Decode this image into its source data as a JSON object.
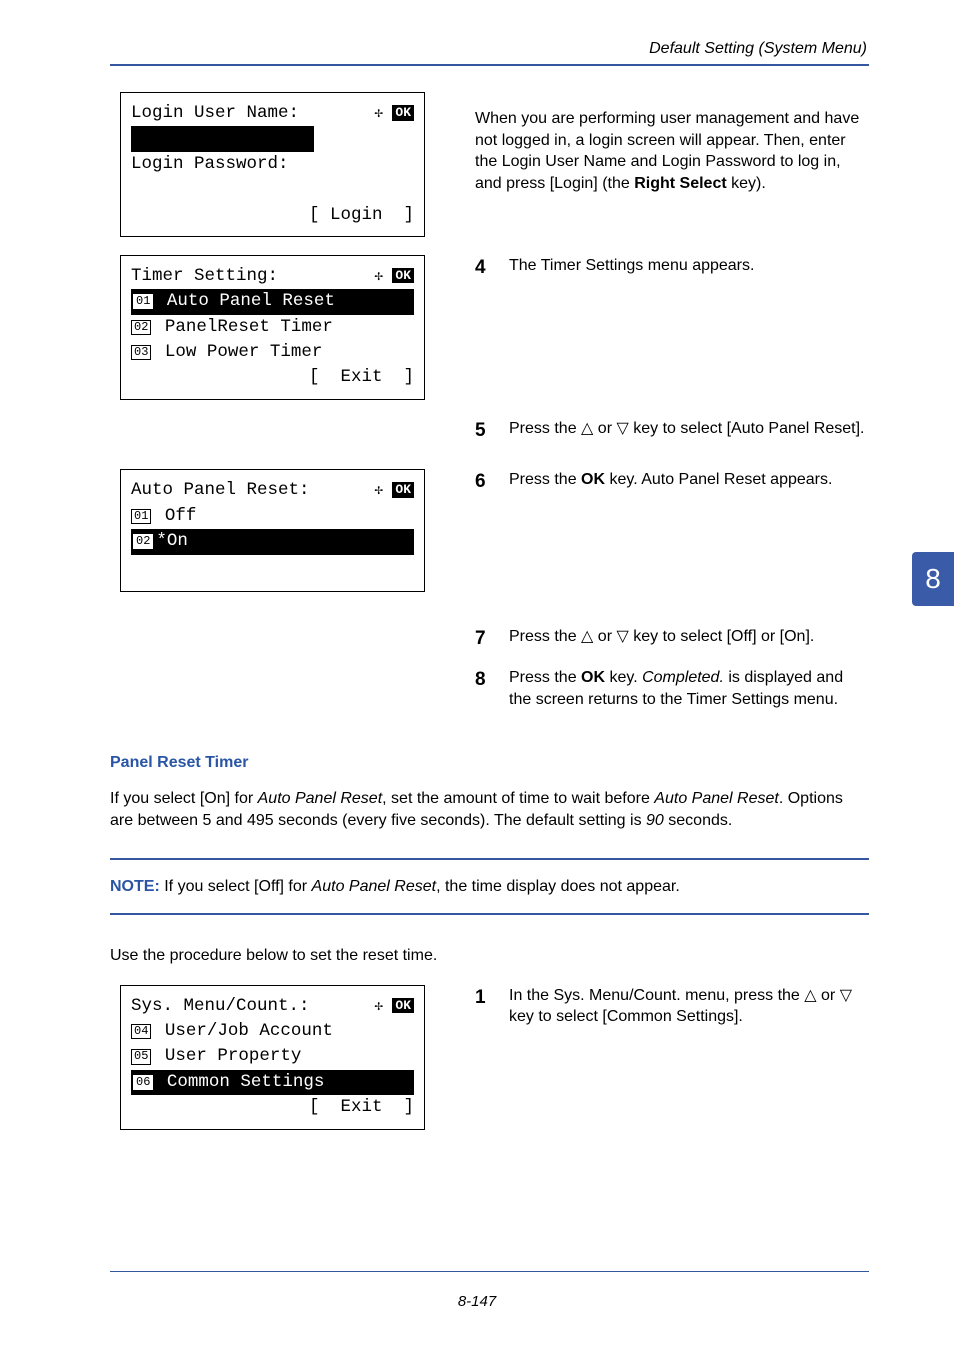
{
  "header": {
    "running": "Default Setting (System Menu)"
  },
  "lcd1": {
    "l1_left": "Login User Name:",
    "l1_right_arrows": "",
    "l1_right_ok": "OK",
    "l2_inv": "                 ",
    "l3": "Login Password:",
    "l5": "[ Login  ]"
  },
  "lcd2": {
    "l1_left": "Timer Setting:",
    "l1_ok": "OK",
    "l2_num": "01",
    "l2_txt": " Auto Panel Reset",
    "l3_num": "02",
    "l3_txt": " PanelReset Timer",
    "l4_num": "03",
    "l4_txt": " Low Power Timer",
    "l5": "[  Exit  ]"
  },
  "lcd3": {
    "l1_left": "Auto Panel Reset:",
    "l1_ok": "OK",
    "l2_num": "01",
    "l2_txt": " Off",
    "l3_num": "02",
    "l3_txt": "*On               "
  },
  "lcd4": {
    "l1_left": "Sys. Menu/Count.:",
    "l1_ok": "OK",
    "l2_num": "04",
    "l2_txt": " User/Job Account",
    "l3_num": "05",
    "l3_txt": " User Property",
    "l4_num": "06",
    "l4_txt": " Common Settings  ",
    "l5": "[  Exit  ]"
  },
  "right": {
    "p1": "When you are performing user management and have not logged in, a login screen will appear. Then, enter the Login User Name and Login Password to log in, and press [Login] (the ",
    "p1b": "Right Select",
    "p1c": " key).",
    "s4": "4",
    "s4t": "The Timer Settings menu appears.",
    "s5": "5",
    "s5t_a": "Press the ",
    "s5t_b": " or ",
    "s5t_c": " key to select [Auto Panel Reset].",
    "s6": "6",
    "s6t_a": "Press the ",
    "s6t_b": "OK",
    "s6t_c": " key. Auto Panel Reset appears.",
    "s7": "7",
    "s7t_a": "Press the ",
    "s7t_b": " or ",
    "s7t_c": " key to select [Off] or [On].",
    "s8": "8",
    "s8t_a": "Press the ",
    "s8t_b": "OK",
    "s8t_c": " key. ",
    "s8t_d": "Completed.",
    "s8t_e": " is displayed and the screen returns to the Timer Settings menu."
  },
  "section": {
    "head": "Panel Reset Timer",
    "p1a": "If you select [On] for ",
    "p1b": "Auto Panel Reset",
    "p1c": ", set the amount of time to wait before ",
    "p1d": "Auto Panel Reset",
    "p1e": ". Options are between 5 and 495 seconds (every five seconds). The default setting is ",
    "p1f": "90",
    "p1g": " seconds.",
    "note_label": "NOTE:",
    "note_a": " If you select [Off] for ",
    "note_b": "Auto Panel Reset",
    "note_c": ", the time display does not appear.",
    "p2": "Use the procedure below to set the reset time.",
    "s1": "1",
    "s1t_a": "In the Sys. Menu/Count. menu, press the ",
    "s1t_b": " or ",
    "s1t_c": " key to select [Common Settings]."
  },
  "tab": "8",
  "footer": "8-147"
}
